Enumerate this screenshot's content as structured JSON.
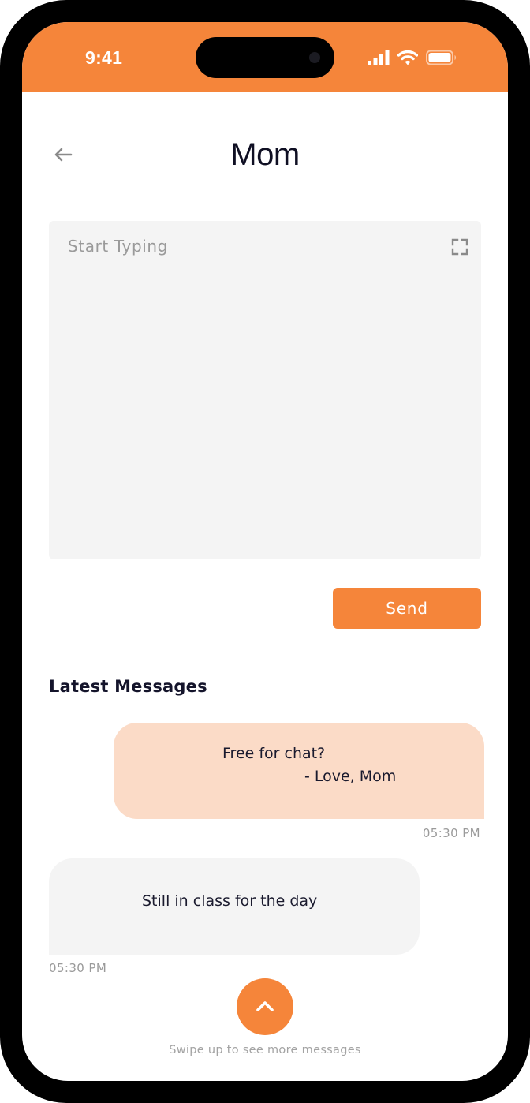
{
  "status_bar": {
    "time": "9:41",
    "icons": [
      "cellular-signal-icon",
      "wifi-icon",
      "battery-icon"
    ]
  },
  "header": {
    "back_icon": "arrow-left-icon",
    "title": "Mom"
  },
  "composer": {
    "placeholder": "Start Typing",
    "value": "",
    "expand_icon": "expand-icon"
  },
  "send_button": {
    "label": "Send"
  },
  "latest_messages": {
    "title": "Latest Messages",
    "messages": [
      {
        "direction": "incoming",
        "lines": [
          "Free for chat?",
          "- Love, Mom"
        ],
        "time": "05:30 PM"
      },
      {
        "direction": "outgoing",
        "lines": [
          "Still in class for the day"
        ],
        "time": "05:30 PM"
      }
    ]
  },
  "swipe": {
    "icon": "chevron-up-icon",
    "hint": "Swipe up to see more messages"
  },
  "colors": {
    "accent": "#F5853A",
    "incoming_bubble": "#FBDBC7",
    "outgoing_bubble": "#F4F4F4",
    "title_text": "#0F0F23",
    "muted_text": "#9A9A9A"
  }
}
